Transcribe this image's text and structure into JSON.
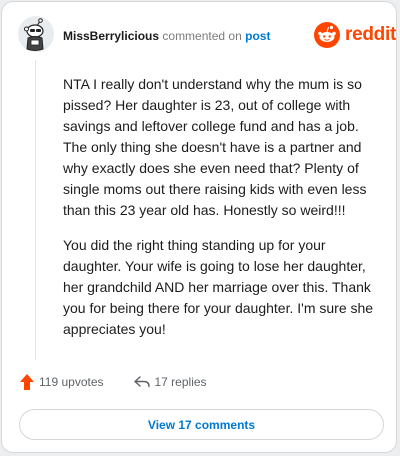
{
  "header": {
    "username": "MissBerrylicious",
    "commented_on": "commented on",
    "post_link": "post",
    "brand": "reddit"
  },
  "comment": {
    "paragraphs": [
      "NTA I really don't understand why the mum is so pissed? Her daughter is 23, out of college with savings and leftover college fund and has a job. The only thing she doesn't have is a partner and why exactly does she even need that? Plenty of single moms out there raising kids with even less than this 23 year old has. Honestly so weird!!!",
      "You did the right thing standing up for your daughter. Your wife is going to lose her daughter, her grandchild AND her marriage over this. Thank you for being there for your daughter. I'm sure she appreciates you!"
    ]
  },
  "actions": {
    "upvotes": "119 upvotes",
    "replies": "17 replies",
    "view_comments": "View 17 comments"
  },
  "icons": {
    "upvote": "upvote-arrow-icon",
    "reply": "reply-arrow-icon",
    "brand": "reddit-snoo-logo",
    "avatar": "snoo-avatar"
  },
  "colors": {
    "brand": "#ff4500",
    "link": "#0079d3",
    "upvote": "#ff4500"
  }
}
